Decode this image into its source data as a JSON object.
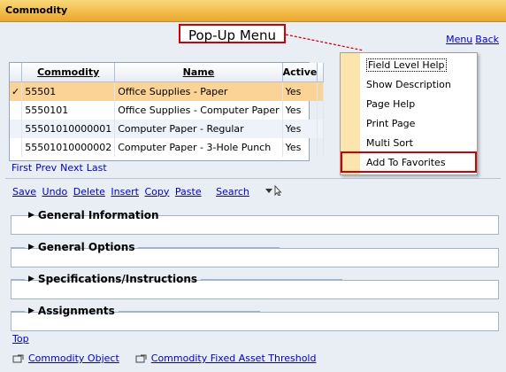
{
  "window": {
    "title": "Commodity"
  },
  "callout": {
    "label": "Pop-Up Menu"
  },
  "topnav": {
    "menu": "Menu",
    "back": "Back"
  },
  "grid": {
    "columns": [
      "Commodity",
      "Name",
      "Active"
    ],
    "rows": [
      {
        "commodity": "55501",
        "name": "Office Supplies - Paper",
        "active": "Yes"
      },
      {
        "commodity": "5550101",
        "name": "Office Supplies - Computer Paper",
        "active": "Yes"
      },
      {
        "commodity": "55501010000001",
        "name": "Computer Paper - Regular",
        "active": "Yes"
      },
      {
        "commodity": "55501010000002",
        "name": "Computer Paper - 3-Hole Punch",
        "active": "Yes"
      }
    ],
    "selected_mark": "✓"
  },
  "pager": {
    "first": "First",
    "prev": "Prev",
    "next": "Next",
    "last": "Last"
  },
  "toolbar": {
    "save": "Save",
    "undo": "Undo",
    "delete": "Delete",
    "insert": "Insert",
    "copy": "Copy",
    "paste": "Paste",
    "search": "Search"
  },
  "sections": {
    "general_information": "General Information",
    "general_options": "General Options",
    "specifications": "Specifications/Instructions",
    "assignments": "Assignments"
  },
  "links": {
    "top": "Top",
    "commodity_object": "Commodity Object",
    "commodity_fixed_asset": "Commodity Fixed Asset Threshold"
  },
  "popup_menu": {
    "items": [
      "Field Level Help",
      "Show Description",
      "Page Help",
      "Print Page",
      "Multi Sort",
      "Add To Favorites"
    ]
  },
  "colors": {
    "title_bar": "#eaa72b",
    "selected_row": "#fbd397",
    "highlight": "#d00000"
  },
  "icons": [
    "checkmark-icon",
    "cursor-pointer-icon",
    "external-link-icon"
  ]
}
